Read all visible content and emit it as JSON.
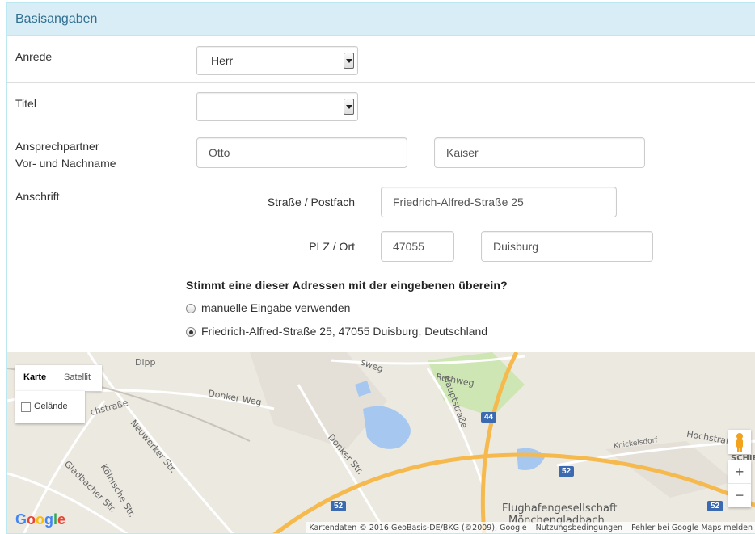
{
  "panel": {
    "title": "Basisangaben"
  },
  "anrede": {
    "label": "Anrede",
    "value": "Herr"
  },
  "titel": {
    "label": "Titel",
    "value": ""
  },
  "ansprechpartner": {
    "label_line1": "Ansprechpartner",
    "label_line2": "Vor- und Nachname",
    "vorname": "Otto",
    "nachname": "Kaiser"
  },
  "anschrift": {
    "label": "Anschrift",
    "strasse_label": "Straße / Postfach",
    "strasse_value": "Friedrich-Alfred-Straße 25",
    "plzort_label": "PLZ / Ort",
    "plz_value": "47055",
    "ort_value": "Duisburg"
  },
  "suggestion": {
    "question": "Stimmt eine dieser Adressen mit der eingebenen überein?",
    "options": [
      {
        "label": "manuelle Eingabe verwenden",
        "selected": false
      },
      {
        "label": "Friedrich-Alfred-Straße 25, 47055 Duisburg, Deutschland",
        "selected": true
      }
    ]
  },
  "map": {
    "type_karte": "Karte",
    "type_satellit": "Satellit",
    "terrain_label": "Gelände",
    "zoom_in": "+",
    "zoom_out": "−",
    "logo": "Google",
    "attribution": {
      "data": "Kartendaten © 2016 GeoBasis-DE/BKG (©2009), Google",
      "terms": "Nutzungsbedingungen",
      "report": "Fehler bei Google Maps melden"
    },
    "labels": {
      "donker_weg": "Donker Weg",
      "donker_str": "Donker Str.",
      "neuwerker_str": "Neuwerker Str.",
      "gladbacher_str": "Gladbacher Str.",
      "koelnische_str": "Kölnische Str.",
      "rothweg": "Rothweg",
      "hauptstrasse": "Hauptstraße",
      "knickelsdorf": "Knickelsdorf",
      "hochstrasse": "Hochstraße",
      "schiefbahn": "SCHIEF",
      "flughafen_1": "Flughafengesellschaft",
      "flughafen_2": "Mönchengladbach",
      "strasse_left": "chstraße",
      "dipp": "Dipp",
      "weg_top": "sweg"
    },
    "shields": {
      "a44": "44",
      "a52_1": "52",
      "a52_2": "52",
      "a52_3": "52"
    },
    "colors": {
      "land": "#ece9e1",
      "motorway": "#f6b94d",
      "water": "#a6c8f0",
      "green": "#cde6b4",
      "shield": "#3b6ab0"
    }
  }
}
